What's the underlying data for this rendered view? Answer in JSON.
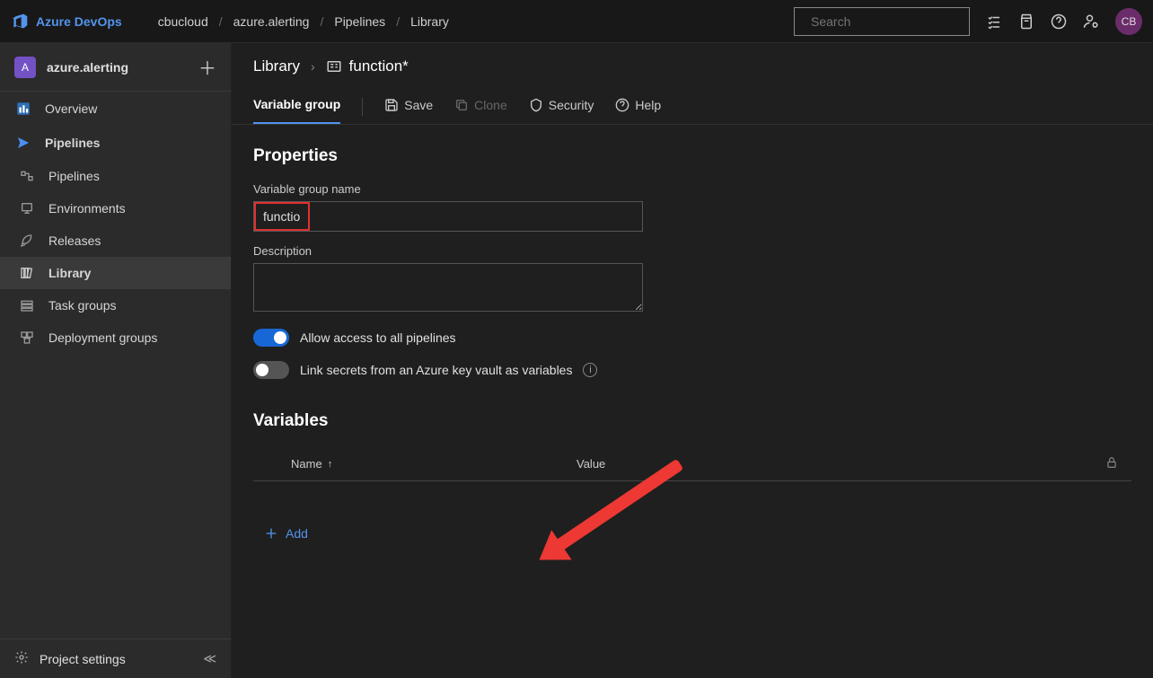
{
  "header": {
    "product": "Azure DevOps",
    "breadcrumbs": [
      "cbucloud",
      "azure.alerting",
      "Pipelines",
      "Library"
    ],
    "search_placeholder": "Search",
    "avatar_initials": "CB"
  },
  "sidebar": {
    "project_initial": "A",
    "project_name": "azure.alerting",
    "items": [
      {
        "icon": "overview",
        "label": "Overview",
        "bold": false,
        "active": false
      },
      {
        "icon": "pipelines",
        "label": "Pipelines",
        "bold": true,
        "active": false
      },
      {
        "icon": "pipelines-sub",
        "label": "Pipelines",
        "bold": false,
        "active": false
      },
      {
        "icon": "environments",
        "label": "Environments",
        "bold": false,
        "active": false
      },
      {
        "icon": "releases",
        "label": "Releases",
        "bold": false,
        "active": false
      },
      {
        "icon": "library",
        "label": "Library",
        "bold": true,
        "active": true
      },
      {
        "icon": "taskgroups",
        "label": "Task groups",
        "bold": false,
        "active": false
      },
      {
        "icon": "deploygroups",
        "label": "Deployment groups",
        "bold": false,
        "active": false
      }
    ],
    "footer": "Project settings"
  },
  "main": {
    "crumb_library": "Library",
    "crumb_item": "function*",
    "tab": "Variable group",
    "actions": {
      "save": "Save",
      "clone": "Clone",
      "security": "Security",
      "help": "Help"
    },
    "properties_heading": "Properties",
    "name_label": "Variable group name",
    "name_value": "function",
    "desc_label": "Description",
    "desc_value": "",
    "toggle1_label": "Allow access to all pipelines",
    "toggle2_label": "Link secrets from an Azure key vault as variables",
    "variables_heading": "Variables",
    "col_name": "Name",
    "col_value": "Value",
    "add_label": "Add"
  }
}
